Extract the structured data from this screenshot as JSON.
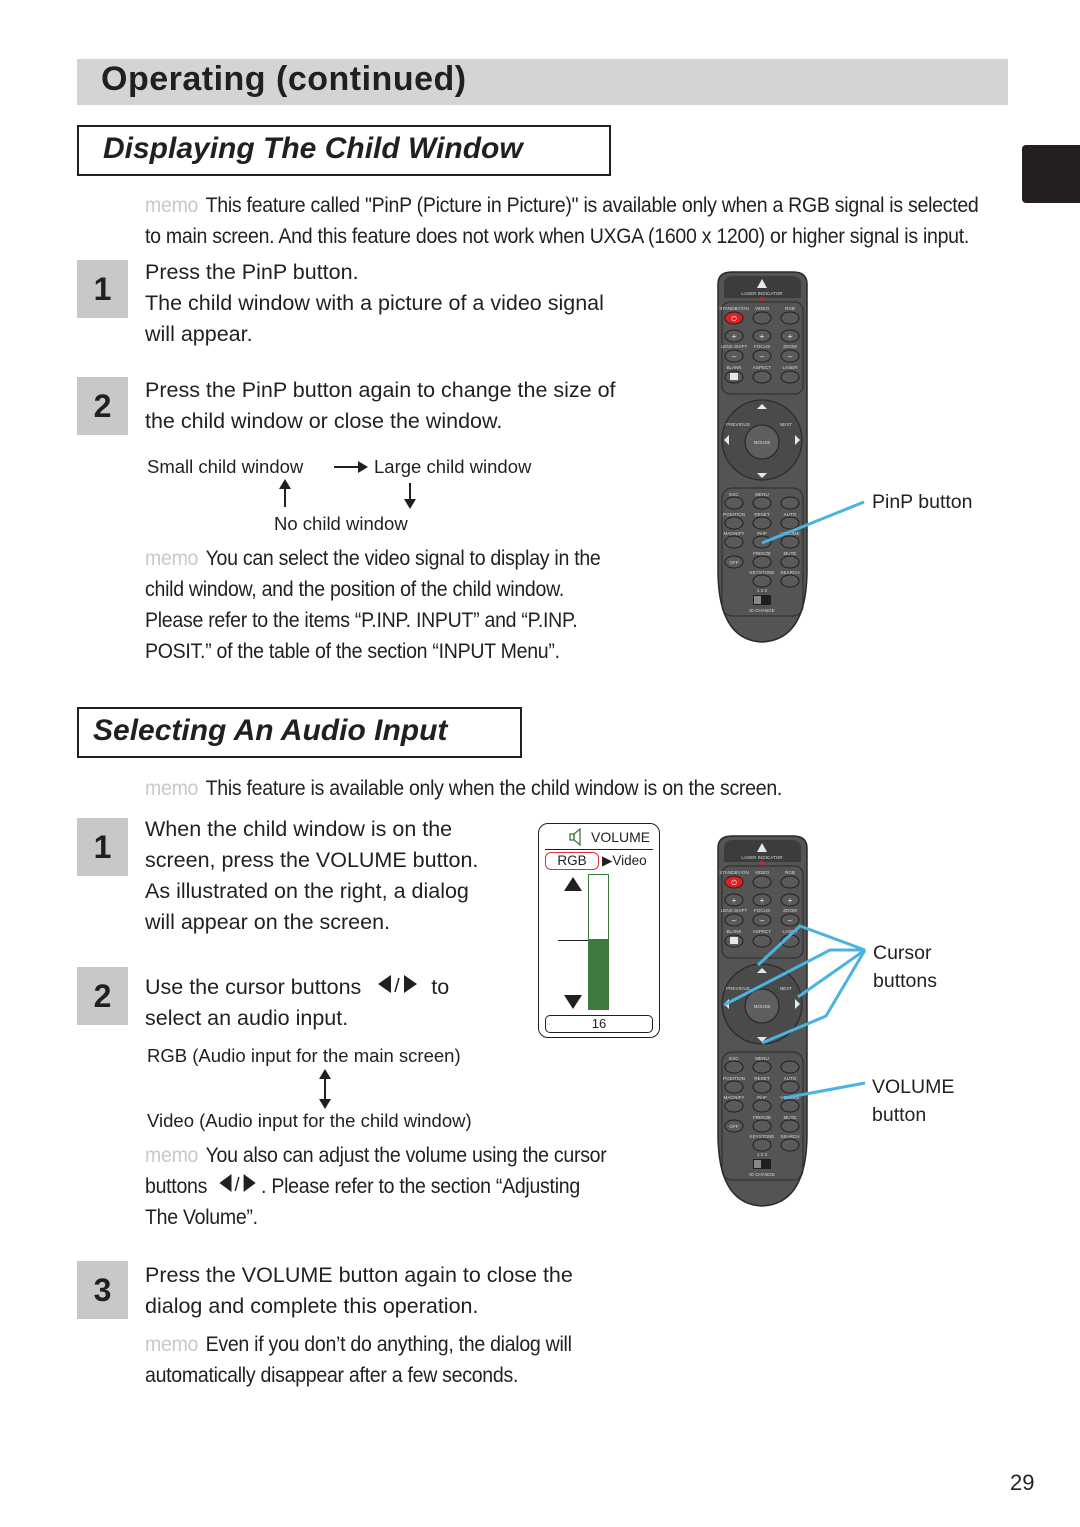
{
  "header": {
    "title": "Operating (continued)"
  },
  "section1": {
    "title": "Displaying The Child Window",
    "memo_label": "memo",
    "memo_line1": "This feature called \"PinP (Picture in Picture)\" is available only when a RGB signal is selected",
    "memo_line2": "to main screen. And this feature does not work when UXGA (1600 x 1200) or higher signal is input.",
    "steps": [
      {
        "num": "1",
        "lines": [
          "Press the PinP button.",
          "The child window with a picture of a video signal",
          "will appear."
        ]
      },
      {
        "num": "2",
        "lines": [
          "Press the PinP button again to change the size of",
          "the child window or close the window."
        ]
      }
    ],
    "flow": {
      "small": "Small child window",
      "large": "Large child window",
      "none": "No child window"
    },
    "memo2_lines": [
      "You can select the video signal to display in the",
      "child window, and the position of the child window.",
      "Please refer to the items “P.INP. INPUT” and “P.INP.",
      "POSIT.” of the table of the section “INPUT Menu”."
    ],
    "callout": "PinP button"
  },
  "section2": {
    "title": "Selecting An Audio Input",
    "memo_label": "memo",
    "memo_line": "This feature is available only when the child window is on the screen.",
    "steps": [
      {
        "num": "1",
        "lines": [
          "When the child window is on the",
          "screen, press the VOLUME button.",
          "As illustrated on the right, a dialog",
          "will appear on the screen."
        ]
      },
      {
        "num": "2",
        "line1_pre": "Use the cursor buttons",
        "line1_post": "to",
        "line2": "select an audio input."
      },
      {
        "num": "3",
        "lines": [
          "Press the VOLUME button again to close the",
          "dialog and complete this operation."
        ]
      }
    ],
    "flow": {
      "rgb": "RGB (Audio input for the main screen)",
      "video": "Video (Audio input for the child window)"
    },
    "memo2_line1": "You also can adjust the volume using the cursor",
    "memo2_line2_pre": "buttons",
    "memo2_line2_post": ". Please refer to the section “Adjusting",
    "memo2_line3": "The Volume”.",
    "memo3_lines": [
      "Even if you don’t do anything, the dialog will",
      "automatically disappear after a few seconds."
    ],
    "callout_cursor": [
      "Cursor",
      "buttons"
    ],
    "callout_volume": [
      "VOLUME",
      "button"
    ]
  },
  "volume_dialog": {
    "title": "VOLUME",
    "selected_input": "RGB",
    "other_input": "Video",
    "value": "16",
    "level_fraction": 0.52,
    "accent_color": "#3f7a3f",
    "highlight_color": "#e0303a"
  },
  "remote": {
    "laser_indicator": "LASER INDICATOR",
    "row1": [
      "STANDBY/ON",
      "VIDEO",
      "RGB"
    ],
    "row2": [
      "LENS SHIFT",
      "FOCUS",
      "ZOOM"
    ],
    "row3": [
      "BLANK",
      "ASPECT",
      "LASER"
    ],
    "pad": [
      "PREVIOUS",
      "NEXT",
      "MOUSE"
    ],
    "row4": [
      "ESC",
      "MENU",
      ""
    ],
    "row5": [
      "POSITION",
      "RESET",
      "AUTO"
    ],
    "row6": [
      "MAGNIFY",
      "PinP",
      "VOLUME"
    ],
    "row6b": [
      "ON",
      "FREEZE",
      "MUTE"
    ],
    "row7": [
      "OFF",
      "KEYSTONE",
      "SEARCH"
    ],
    "id_nums": "1 2 3",
    "id_change": "ID CHANGE",
    "callout_color": "#4ab3e0"
  },
  "page": {
    "number": "29"
  }
}
